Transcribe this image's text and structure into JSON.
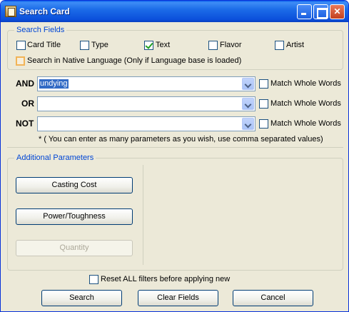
{
  "window": {
    "title": "Search Card"
  },
  "search_fields": {
    "title": "Search Fields",
    "checkboxes": [
      {
        "label": "Card Title",
        "checked": false
      },
      {
        "label": "Type",
        "checked": false
      },
      {
        "label": "Text",
        "checked": true
      },
      {
        "label": "Flavor",
        "checked": false
      },
      {
        "label": "Artist",
        "checked": false
      }
    ],
    "native_language": {
      "label": "Search in Native Language (Only if Language base is loaded)",
      "checked": false
    }
  },
  "criteria": [
    {
      "operator": "AND",
      "value": "undying",
      "match_label": "Match Whole Words",
      "match_checked": false
    },
    {
      "operator": "OR",
      "value": "",
      "match_label": "Match Whole Words",
      "match_checked": false
    },
    {
      "operator": "NOT",
      "value": "",
      "match_label": "Match Whole Words",
      "match_checked": false
    }
  ],
  "hint": "* ( You can enter as many parameters as you wish, use comma separated values)",
  "additional": {
    "title": "Additional Parameters",
    "buttons": [
      {
        "label": "Casting Cost",
        "enabled": true
      },
      {
        "label": "Power/Toughness",
        "enabled": true
      },
      {
        "label": "Quantity",
        "enabled": false
      }
    ]
  },
  "reset": {
    "label": "Reset ALL filters before applying new",
    "checked": false
  },
  "footer": {
    "search": "Search",
    "clear": "Clear Fields",
    "cancel": "Cancel"
  },
  "colors": {
    "title_bar": "#0A5FEA",
    "face": "#ECE9D8",
    "group_title": "#0046D5"
  }
}
